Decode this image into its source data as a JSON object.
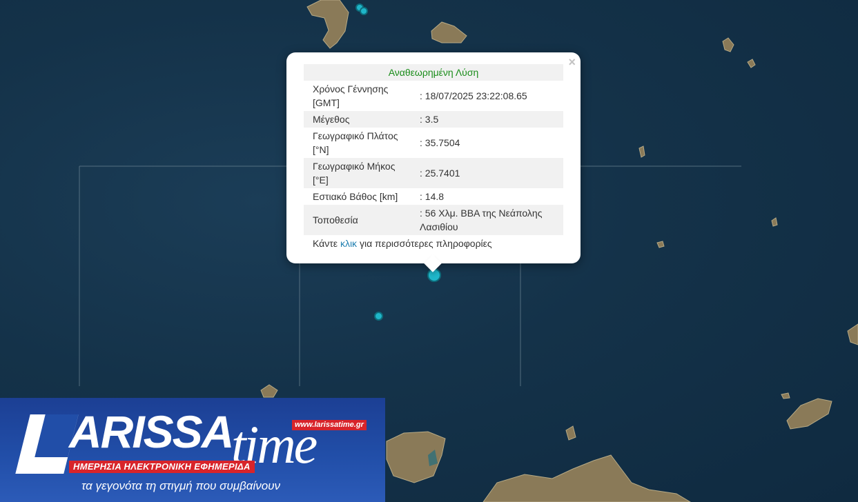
{
  "popup": {
    "title": "Αναθεωρημένη Λύση",
    "close_label": "×",
    "rows": [
      {
        "label": "Χρόνος Γέννησης [GMT]",
        "value": ": 18/07/2025 23:22:08.65"
      },
      {
        "label": "Μέγεθος",
        "value": ": 3.5"
      },
      {
        "label": "Γεωγραφικό Πλάτος [°N]",
        "value": ": 35.7504"
      },
      {
        "label": "Γεωγραφικό Μήκος [°E]",
        "value": ": 25.7401"
      },
      {
        "label": "Εστιακό Βάθος [km]",
        "value": ": 14.8"
      },
      {
        "label": "Τοποθεσία",
        "value": ": 56 Χλμ. ΒΒΑ της Νεάπολης Λασιθίου"
      }
    ],
    "more_prefix": "Κάντε",
    "more_link": "κλικ",
    "more_suffix": "για περισσότερες πληροφορίες"
  },
  "logo": {
    "brand_main": "ARISSA",
    "brand_script": "time",
    "url": "www.larissatime.gr",
    "tagline_red": "ΗΜΕΡΗΣΙΑ ΗΛΕΚΤΡΟΝΙΚΗ ΕΦΗΜΕΡΙΔΑ",
    "tagline": "τα γεγονότα τη στιγμή που συμβαίνουν"
  },
  "colors": {
    "sea": "#14324a",
    "land": "#7a6a4a",
    "marker": "#1fb6c9",
    "title_green": "#198c19",
    "link_blue": "#1f7fb0",
    "logo_blue": "#214ea8",
    "logo_red": "#d8242a"
  }
}
